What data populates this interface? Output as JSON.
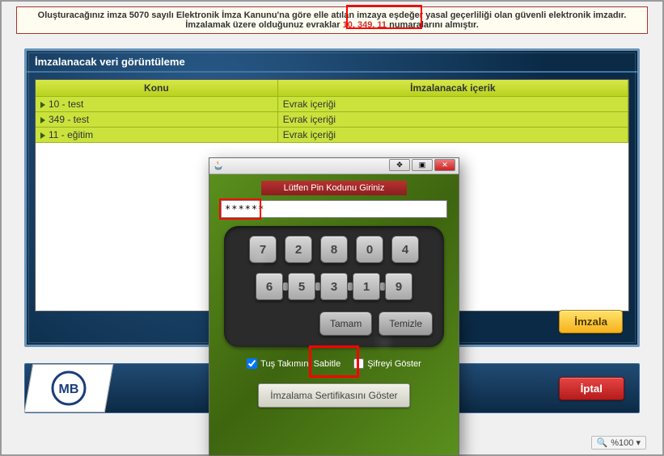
{
  "notice": {
    "part1": "Oluşturacağınız imza 5070 sayılı Elektronik İmza Kanunu'na göre elle atılan imzaya eşdeğer yasal geçerliliği olan güvenli elektronik imzadır. İmzalamak üzere olduğunuz evraklar ",
    "nums": "10, 349, 11",
    "part2": " numaralarını almıştır."
  },
  "panel": {
    "title": "İmzalanacak veri görüntüleme",
    "columns": {
      "subject": "Konu",
      "content": "İmzalanacak içerik"
    },
    "rows": [
      {
        "subject": "10 - test",
        "content": "Evrak içeriği"
      },
      {
        "subject": "349 - test",
        "content": "Evrak içeriği"
      },
      {
        "subject": "11 - eğitim",
        "content": "Evrak içeriği"
      }
    ],
    "sign_label": "İmzala"
  },
  "cancel_label": "İptal",
  "zoom": {
    "level": "%100"
  },
  "pin_dialog": {
    "header": "Lütfen Pin Kodunu Giriniz",
    "pin_value": "******",
    "keys_row1": [
      "7",
      "2",
      "8",
      "0",
      "4"
    ],
    "keys_row2": [
      "6",
      "5",
      "3",
      "1",
      "9"
    ],
    "ok_label": "Tamam",
    "clear_label": "Temizle",
    "fix_keypad_label": "Tuş Takımını Sabitle",
    "show_pw_label": "Şifreyi Göster",
    "cert_label": "İmzalama Sertifikasını Göster"
  }
}
